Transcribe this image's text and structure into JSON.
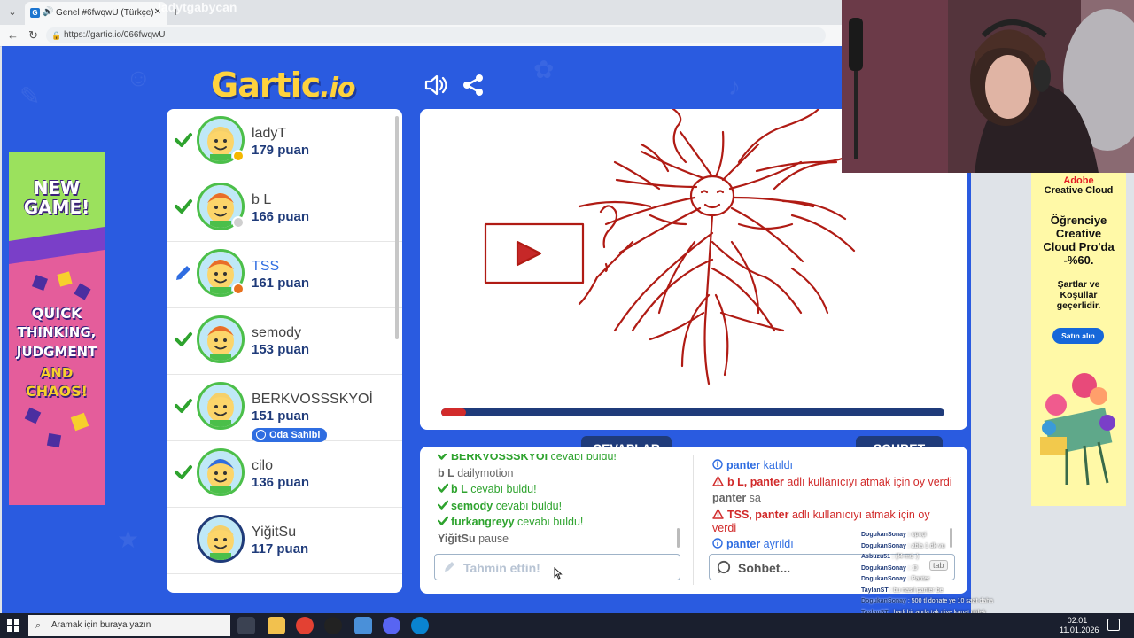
{
  "browser": {
    "tab_title": "Genel #6fwqwU (Türkçe) - Gar",
    "url": "https://gartic.io/066fwqwU",
    "overlay_name": "ladytgabycan"
  },
  "logo": {
    "main": "Gartic",
    "suffix": ".io"
  },
  "players": [
    {
      "name": "ladyT",
      "score": "179 puan",
      "status": "check",
      "name_color": "#444444",
      "dot": "#f5b800",
      "border": "#4bbf4a",
      "hair": "#f5d06a"
    },
    {
      "name": "b L",
      "score": "166 puan",
      "status": "check",
      "name_color": "#444444",
      "dot": "#cfcfcf",
      "border": "#4bbf4a",
      "hair": "#e86d2a"
    },
    {
      "name": "TSS",
      "score": "161 puan",
      "status": "pencil",
      "name_color": "#2f6de1",
      "dot": "#e8701c",
      "border": "#4bbf4a",
      "hair": "#e86d2a"
    },
    {
      "name": "semody",
      "score": "153 puan",
      "status": "check",
      "name_color": "#444444",
      "dot": "",
      "border": "#4bbf4a",
      "hair": "#e86d2a"
    },
    {
      "name": "BERKVOSSSKYOİ",
      "score": "151 puan",
      "status": "check",
      "name_color": "#444444",
      "dot": "",
      "border": "#4bbf4a",
      "hair": "#f5d06a"
    },
    {
      "name": "cilo",
      "score": "136 puan",
      "status": "check",
      "name_color": "#444444",
      "dot": "",
      "border": "#4bbf4a",
      "hair": "#2f6de1"
    },
    {
      "name": "YiğitSu",
      "score": "117 puan",
      "status": "none",
      "name_color": "#444444",
      "dot": "",
      "border": "#1f3b7a",
      "hair": "#f5d06a"
    }
  ],
  "room_owner_label": "Oda Sahibi",
  "progress_fraction": 0.05,
  "tabs": {
    "answers": "CEVAPLAR",
    "chat": "SOHBET"
  },
  "answers": [
    {
      "name": "BERKVOSSSKYOİ",
      "text": " cevabı buldu!",
      "type": "found"
    },
    {
      "name": "b L",
      "text": " dailymotion",
      "type": "guess"
    },
    {
      "name": "b L",
      "text": " cevabı buldu!",
      "type": "found"
    },
    {
      "name": "semody",
      "text": " cevabı buldu!",
      "type": "found"
    },
    {
      "name": "furkangreyy",
      "text": " cevabı buldu!",
      "type": "found"
    },
    {
      "name": "YiğitSu",
      "text": " pause",
      "type": "guess"
    }
  ],
  "chat": [
    {
      "name": "panter",
      "text": " katıldı",
      "type": "info"
    },
    {
      "name": "b L, panter",
      "text": " adlı kullanıcıyı atmak için oy verdi",
      "type": "warn"
    },
    {
      "name": "panter",
      "text": " sa",
      "type": "msg"
    },
    {
      "name": "TSS, panter",
      "text": " adlı kullanıcıyı atmak için oy verdi",
      "type": "warn"
    },
    {
      "name": "panter",
      "text": " ayrıldı",
      "type": "info"
    }
  ],
  "guess_placeholder": "Tahmin ettin!",
  "chat_placeholder": "Sohbet...",
  "ad_left": {
    "line1": "NEW",
    "line2": "GAME!",
    "line3": "QUICK",
    "line4": "THINKING,",
    "line5": "JUDGMENT",
    "line6": "AND",
    "line7": "CHAOS!"
  },
  "ad_right": {
    "brand": "Adobe",
    "product": "Creative Cloud",
    "headline1": "Öğrenciye",
    "headline2": "Creative",
    "headline3": "Cloud Pro'da",
    "headline4": "-%60.",
    "terms1": "Şartlar ve",
    "terms2": "Koşullar",
    "terms3": "geçerlidir.",
    "cta": "Satın alın"
  },
  "stream_chat": [
    {
      "user": "DogukanSonay",
      "text": ": opoçi"
    },
    {
      "user": "DogukanSonay",
      "text": ": abla 1 dk vu"
    },
    {
      "user": "Asbuzu51",
      "text": ": (f4 mü :)"
    },
    {
      "user": "DogukanSonay",
      "text": ": :D"
    },
    {
      "user": "DogukanSonay",
      "text": ": Panter"
    },
    {
      "user": "TaylanST",
      "text": ": bu nasıl panter be"
    },
    {
      "user": "DogukanSonay",
      "text": ": 500 tl donate ye 10 saat daha"
    },
    {
      "user": "TaylanST",
      "text": ": hadi bir anda tak diye kapat gidek"
    }
  ],
  "tab_key_label": "tab",
  "taskbar": {
    "search_placeholder": "Aramak için buraya yazın",
    "time": "02:01",
    "date": "11.01.2026"
  },
  "colors": {
    "game_bg": "#2a5be0",
    "accent_dark": "#1f3b7a",
    "check_green": "#2ea32e",
    "pencil_blue": "#2f6de1",
    "drawing_red": "#b01b14"
  },
  "icons": [
    "speaker-icon",
    "share-icon",
    "check-icon",
    "pencil-icon",
    "info-icon",
    "warning-icon",
    "chat-bubble-icon",
    "search-icon",
    "windows-icon"
  ]
}
